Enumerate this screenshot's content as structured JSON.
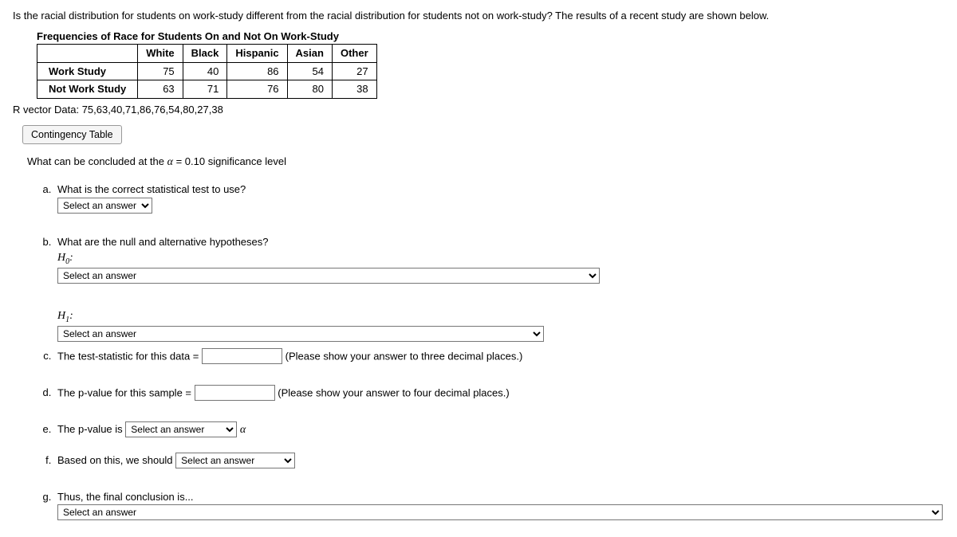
{
  "intro": "Is the racial distribution for students on work-study different from the racial distribution for students not on work-study? The results of a recent study are shown below.",
  "table": {
    "title": "Frequencies of Race for Students On and Not On Work-Study",
    "headers": [
      "White",
      "Black",
      "Hispanic",
      "Asian",
      "Other"
    ],
    "rows": [
      {
        "label": "Work Study",
        "cells": [
          "75",
          "40",
          "86",
          "54",
          "27"
        ]
      },
      {
        "label": "Not Work Study",
        "cells": [
          "63",
          "71",
          "76",
          "80",
          "38"
        ]
      }
    ]
  },
  "rvector": "R vector Data: 75,63,40,71,86,76,54,80,27,38",
  "buttons": {
    "contingency": "Contingency Table"
  },
  "conclude_prefix": "What can be concluded at the ",
  "conclude_alpha": "α",
  "conclude_suffix": " = 0.10 significance level",
  "qa": {
    "a": {
      "text": "What is the correct statistical test to use?",
      "placeholder": "Select an answer"
    },
    "b": {
      "text": "What are the null and alternative hypotheses?",
      "h0": "H",
      "h0sub": "0",
      "h1": "H",
      "h1sub": "1",
      "placeholder": "Select an answer"
    },
    "c": {
      "text": " The test-statistic for this data =",
      "hint": "(Please show your answer to three decimal places.)"
    },
    "d": {
      "text": "The p-value for this sample =",
      "hint": "(Please show your answer to four decimal places.)"
    },
    "e": {
      "text": "The p-value is ",
      "placeholder": "Select an answer",
      "alpha": "α"
    },
    "f": {
      "text": "Based on this, we should ",
      "placeholder": "Select an answer"
    },
    "g": {
      "text": "Thus, the final conclusion is...",
      "placeholder": "Select an answer"
    }
  }
}
